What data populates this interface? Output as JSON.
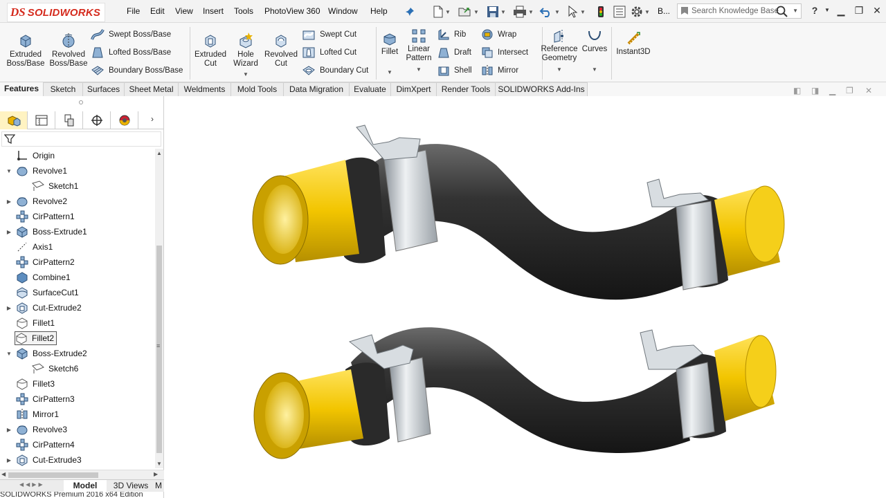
{
  "app": {
    "brand_mark": "DS",
    "brand_name": "SOLIDWORKS"
  },
  "menu": [
    "File",
    "Edit",
    "View",
    "Insert",
    "Tools",
    "PhotoView 360",
    "Window",
    "Help"
  ],
  "quick_access": {
    "icons": [
      "pushpin-icon",
      "new-document-icon",
      "open-folder-icon",
      "save-icon",
      "print-icon",
      "undo-icon",
      "select-arrow-icon",
      "rebuild-traffic-light-icon",
      "file-properties-icon",
      "options-gear-icon"
    ],
    "overflow_label": "B..."
  },
  "search": {
    "placeholder": "Search Knowledge Base"
  },
  "ribbon": {
    "extruded_boss": "Extruded Boss/Base",
    "revolved_boss": "Revolved Boss/Base",
    "swept_boss": "Swept Boss/Base",
    "lofted_boss": "Lofted Boss/Base",
    "boundary_boss": "Boundary Boss/Base",
    "extruded_cut": "Extruded Cut",
    "hole_wizard": "Hole Wizard",
    "revolved_cut": "Revolved Cut",
    "swept_cut": "Swept Cut",
    "lofted_cut": "Lofted Cut",
    "boundary_cut": "Boundary Cut",
    "fillet": "Fillet",
    "linear_pattern": "Linear Pattern",
    "rib": "Rib",
    "draft": "Draft",
    "shell": "Shell",
    "wrap": "Wrap",
    "intersect": "Intersect",
    "mirror": "Mirror",
    "reference_geometry": "Reference Geometry",
    "curves": "Curves",
    "instant3d": "Instant3D"
  },
  "command_tabs": [
    "Features",
    "Sketch",
    "Surfaces",
    "Sheet Metal",
    "Weldments",
    "Mold Tools",
    "Data Migration",
    "Evaluate",
    "DimXpert",
    "Render Tools",
    "SOLIDWORKS Add-Ins"
  ],
  "active_tab": "Features",
  "feature_tree": [
    {
      "label": "Origin",
      "icon": "origin-icon",
      "indent": 0,
      "expandable": false
    },
    {
      "label": "Revolve1",
      "icon": "revolve-icon",
      "indent": 0,
      "expandable": true,
      "expanded": true
    },
    {
      "label": "Sketch1",
      "icon": "sketch-icon",
      "indent": 1,
      "expandable": false
    },
    {
      "label": "Revolve2",
      "icon": "revolve-icon",
      "indent": 0,
      "expandable": true
    },
    {
      "label": "CirPattern1",
      "icon": "circular-pattern-icon",
      "indent": 0,
      "expandable": false
    },
    {
      "label": "Boss-Extrude1",
      "icon": "extrude-icon",
      "indent": 0,
      "expandable": true
    },
    {
      "label": "Axis1",
      "icon": "axis-icon",
      "indent": 0,
      "expandable": false
    },
    {
      "label": "CirPattern2",
      "icon": "circular-pattern-icon",
      "indent": 0,
      "expandable": false
    },
    {
      "label": "Combine1",
      "icon": "combine-icon",
      "indent": 0,
      "expandable": false
    },
    {
      "label": "SurfaceCut1",
      "icon": "surface-cut-icon",
      "indent": 0,
      "expandable": false
    },
    {
      "label": "Cut-Extrude2",
      "icon": "cut-extrude-icon",
      "indent": 0,
      "expandable": true
    },
    {
      "label": "Fillet1",
      "icon": "fillet-icon",
      "indent": 0,
      "expandable": false
    },
    {
      "label": "Fillet2",
      "icon": "fillet-icon",
      "indent": 0,
      "expandable": false,
      "selected": true
    },
    {
      "label": "Boss-Extrude2",
      "icon": "extrude-icon",
      "indent": 0,
      "expandable": true,
      "expanded": true
    },
    {
      "label": "Sketch6",
      "icon": "sketch-icon",
      "indent": 1,
      "expandable": false
    },
    {
      "label": "Fillet3",
      "icon": "fillet-icon",
      "indent": 0,
      "expandable": false
    },
    {
      "label": "CirPattern3",
      "icon": "circular-pattern-icon",
      "indent": 0,
      "expandable": false
    },
    {
      "label": "Mirror1",
      "icon": "mirror-icon",
      "indent": 0,
      "expandable": false
    },
    {
      "label": "Revolve3",
      "icon": "revolve-icon",
      "indent": 0,
      "expandable": true
    },
    {
      "label": "CirPattern4",
      "icon": "circular-pattern-icon",
      "indent": 0,
      "expandable": false
    },
    {
      "label": "Cut-Extrude3",
      "icon": "cut-extrude-icon",
      "indent": 0,
      "expandable": true
    }
  ],
  "bottom_tabs": [
    "Model",
    "3D Views",
    "M"
  ],
  "status_bar": "SOLIDWORKS Premium 2016 x64 Edition",
  "colors": {
    "hose": "#2c2c2c",
    "fitting": "#f2c500",
    "clamp": "#c9ced3",
    "brand": "#d52b1e"
  }
}
